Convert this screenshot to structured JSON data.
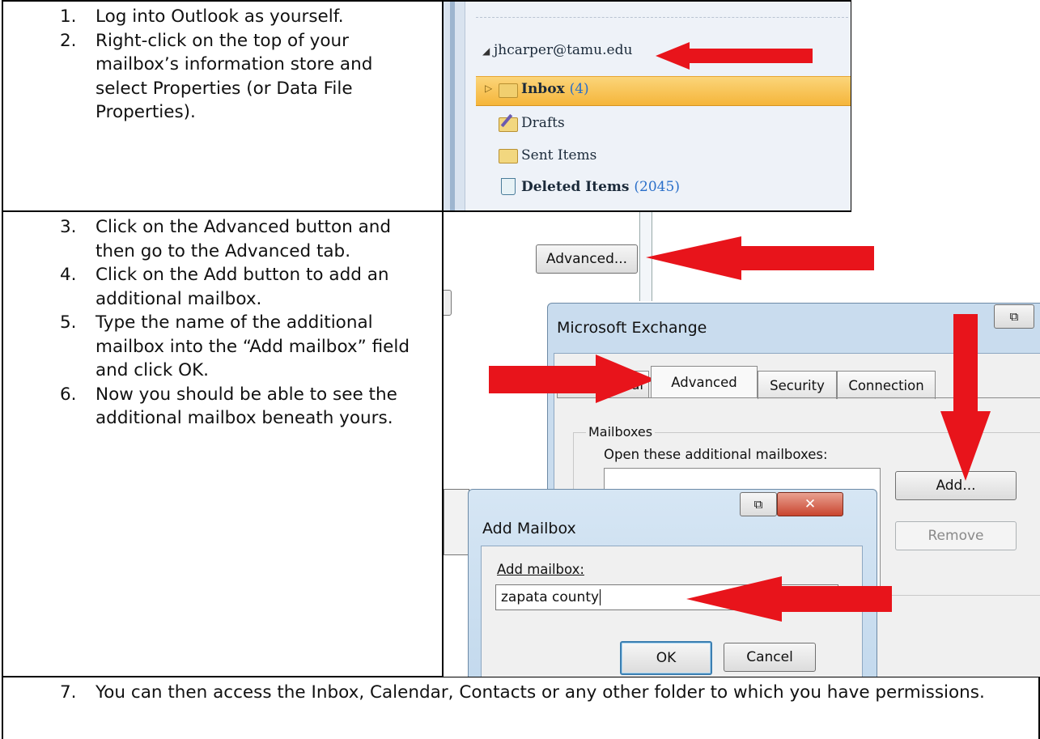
{
  "steps": {
    "s1": {
      "num": "1.",
      "text": "Log into Outlook as yourself."
    },
    "s2": {
      "num": "2.",
      "text": "Right-click on the top of your mailbox’s information store and select Properties (or Data File Properties)."
    },
    "s3": {
      "num": "3.",
      "text": "Click on the Advanced button and then go to the Advanced tab."
    },
    "s4": {
      "num": "4.",
      "text": "Click on the Add button to add an additional mailbox."
    },
    "s5": {
      "num": "5.",
      "text": "Type the name of the additional mailbox into the “Add mailbox” field and click OK."
    },
    "s6": {
      "num": "6.",
      "text": "Now you should be able to see the additional mailbox beneath yours."
    },
    "s7": {
      "num": "7.",
      "text": "You can then access the Inbox, Calendar, Contacts or any other folder to which you have permissions."
    }
  },
  "folder_pane": {
    "account": "jhcarper@tamu.edu",
    "inbox": "Inbox",
    "inbox_count": "(4)",
    "drafts": "Drafts",
    "sent": "Sent Items",
    "deleted": "Deleted Items",
    "deleted_count": "(2045)"
  },
  "exchange": {
    "advanced_button": "Advanced...",
    "dialog_title": "Microsoft Exchange",
    "tabs": [
      "eneral",
      "Advanced",
      "Security",
      "Connection"
    ],
    "group_label": "Mailboxes",
    "open_label": "Open these additional mailboxes:",
    "add_button": "Add...",
    "remove_button": "Remove"
  },
  "add_mailbox": {
    "title": "Add Mailbox",
    "field_label": "Add mailbox:",
    "field_value": "zapata county",
    "ok": "OK",
    "cancel": "Cancel"
  },
  "colors": {
    "arrow": "#e8141b",
    "inbox_count": "#2a6fc9"
  }
}
